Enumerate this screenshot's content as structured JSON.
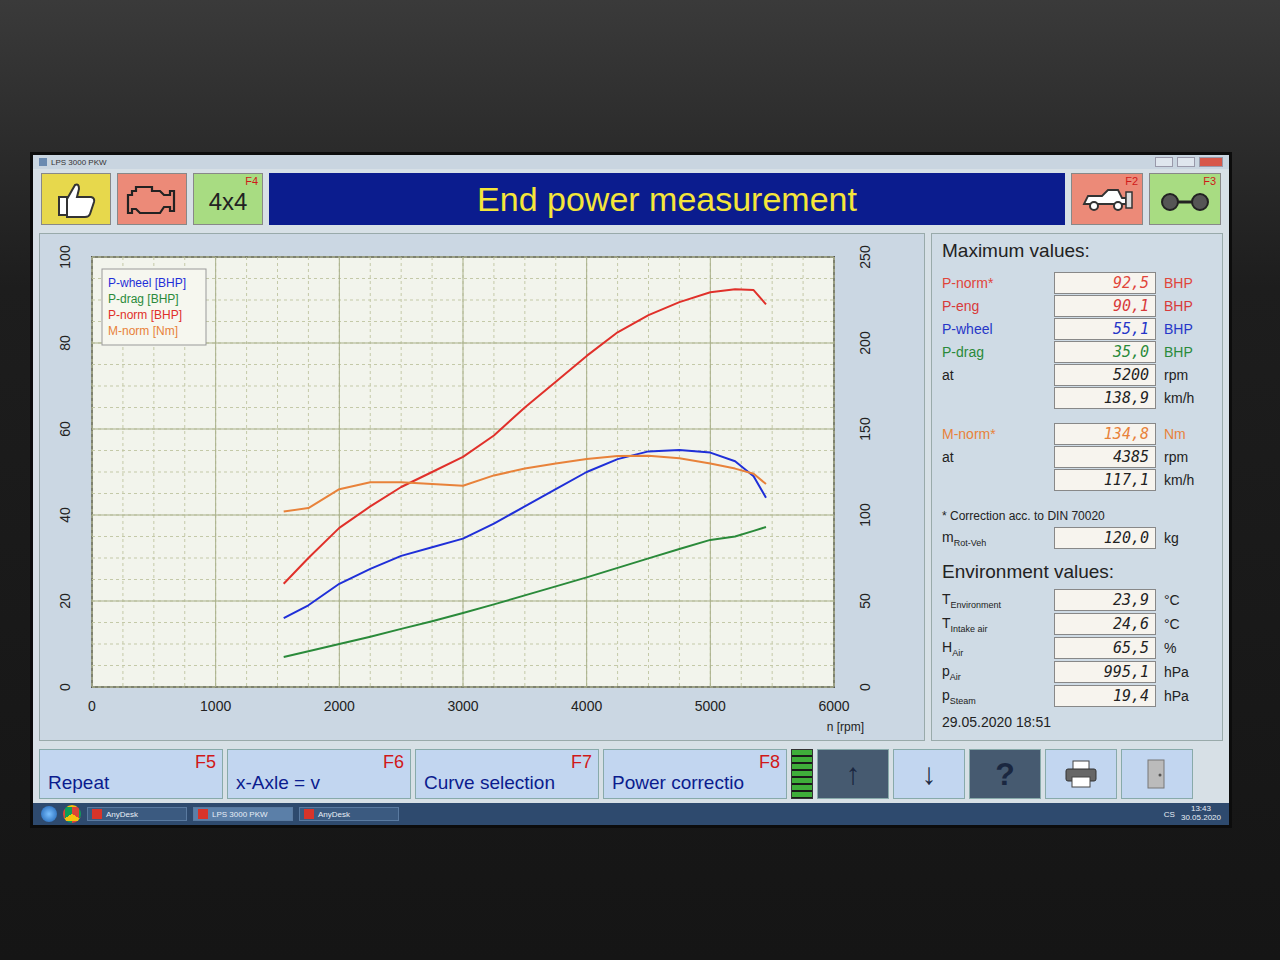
{
  "window": {
    "title": "LPS 3000 PKW"
  },
  "toolbar": {
    "mode_label": "4x4",
    "mode_key": "F4",
    "title": "End power measurement",
    "car_key": "F2",
    "axle_key": "F3"
  },
  "chart": {
    "x_ticks": [
      "0",
      "1000",
      "2000",
      "3000",
      "4000",
      "5000",
      "6000"
    ],
    "x_label": "n [rpm]",
    "left_ticks": [
      "0",
      "20",
      "40",
      "60",
      "80",
      "100"
    ],
    "right_ticks": [
      "0",
      "50",
      "100",
      "150",
      "200",
      "250"
    ],
    "rpm": [
      1550,
      1750,
      2000,
      2250,
      2500,
      2750,
      3000,
      3250,
      3500,
      3750,
      4000,
      4250,
      4500,
      4750,
      5000,
      5200,
      5350,
      5450
    ],
    "series": [
      {
        "name": "P-wheel [BHP]",
        "axis": "left",
        "color": "#1f2fd8",
        "values": [
          16,
          19,
          24,
          27.5,
          30.5,
          32.5,
          34.5,
          38,
          42,
          46,
          50,
          53,
          54.8,
          55.1,
          54.5,
          52.5,
          49,
          44
        ]
      },
      {
        "name": "P-drag [BHP]",
        "axis": "left",
        "color": "#2a8a3a",
        "values": [
          7,
          8.3,
          10,
          11.7,
          13.5,
          15.3,
          17.2,
          19.2,
          21.3,
          23.4,
          25.5,
          27.7,
          29.9,
          32.1,
          34.2,
          35.0,
          36.3,
          37.2
        ]
      },
      {
        "name": "P-norm [BHP]",
        "axis": "left",
        "color": "#e0302a",
        "values": [
          24,
          30,
          37,
          42,
          46.5,
          50,
          53.5,
          58.5,
          65,
          71,
          77,
          82.5,
          86.5,
          89.5,
          91.8,
          92.5,
          92.3,
          89
        ]
      },
      {
        "name": "M-norm [Nm]",
        "axis": "right",
        "color": "#e8823a",
        "values": [
          102,
          104,
          115,
          119,
          119,
          118,
          117,
          123,
          127,
          130,
          132.5,
          134.3,
          134.5,
          133,
          130,
          127,
          124,
          118
        ]
      }
    ]
  },
  "max_values": {
    "title": "Maximum values:",
    "groups": [
      [
        {
          "label": "P-norm*",
          "value": "92,5",
          "unit": "BHP",
          "color": "#e0453a"
        },
        {
          "label": "P-eng",
          "value": "90,1",
          "unit": "BHP",
          "color": "#d83a3a"
        },
        {
          "label": "P-wheel",
          "value": "55,1",
          "unit": "BHP",
          "color": "#2636c8"
        },
        {
          "label": "P-drag",
          "value": "35,0",
          "unit": "BHP",
          "color": "#2a8a3a"
        },
        {
          "label": "at",
          "value": "5200",
          "unit": "rpm",
          "color": "#222222"
        },
        {
          "label": "",
          "value": "138,9",
          "unit": "km/h",
          "color": "#222222"
        }
      ],
      [
        {
          "label": "M-norm*",
          "value": "134,8",
          "unit": "Nm",
          "color": "#e8823a"
        },
        {
          "label": "at",
          "value": "4385",
          "unit": "rpm",
          "color": "#222222"
        },
        {
          "label": "",
          "value": "117,1",
          "unit": "km/h",
          "color": "#222222"
        }
      ]
    ],
    "note": "* Correction acc. to DIN 70020",
    "mass": {
      "symbol": "m",
      "sub": "Rot-Veh",
      "value": "120,0",
      "unit": "kg"
    }
  },
  "environment": {
    "title": "Environment values:",
    "rows": [
      {
        "symbol": "T",
        "sub": "Environment",
        "value": "23,9",
        "unit": "°C"
      },
      {
        "symbol": "T",
        "sub": "Intake air",
        "value": "24,6",
        "unit": "°C"
      },
      {
        "symbol": "H",
        "sub": "Air",
        "value": "65,5",
        "unit": "%"
      },
      {
        "symbol": "p",
        "sub": "Air",
        "value": "995,1",
        "unit": "hPa"
      },
      {
        "symbol": "p",
        "sub": "Steam",
        "value": "19,4",
        "unit": "hPa"
      }
    ]
  },
  "timestamp": "29.05.2020 18:51",
  "function_keys": [
    {
      "label": "Repeat",
      "key": "F5"
    },
    {
      "label": "x-Axle = v",
      "key": "F6"
    },
    {
      "label": "Curve selection",
      "key": "F7"
    },
    {
      "label": "Power correctio",
      "key": "F8"
    }
  ],
  "indicator": {
    "level": 1
  },
  "nav_buttons": {
    "up": "↑",
    "down": "↓",
    "help": "?"
  },
  "taskbar": {
    "items": [
      {
        "label": "AnyDesk",
        "selected": false
      },
      {
        "label": "LPS 3000 PKW",
        "selected": true
      },
      {
        "label": "AnyDesk",
        "selected": false
      }
    ],
    "tray": {
      "lang": "CS",
      "time": "13:43",
      "date": "30.05.2020"
    }
  }
}
